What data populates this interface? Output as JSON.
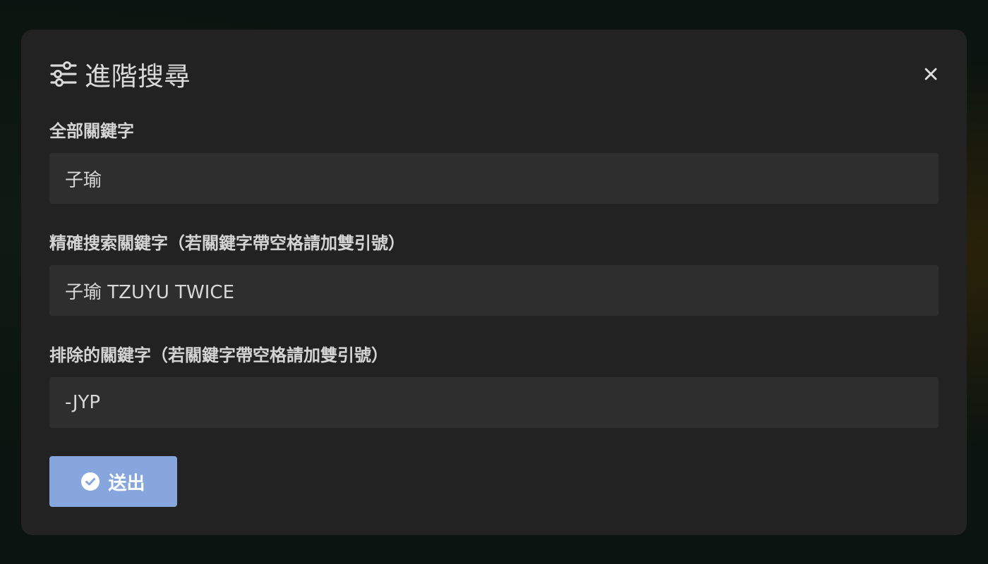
{
  "modal": {
    "title": "進階搜尋",
    "title_icon": "sliders-icon",
    "close_icon": "close-icon"
  },
  "fields": {
    "all_keywords": {
      "label": "全部關鍵字",
      "value": "子瑜"
    },
    "exact_keywords": {
      "label": "精確搜索關鍵字（若關鍵字帶空格請加雙引號）",
      "value": "子瑜 TZUYU TWICE"
    },
    "excluded_keywords": {
      "label": "排除的關鍵字（若關鍵字帶空格請加雙引號）",
      "value": "-JYP"
    }
  },
  "submit": {
    "label": "送出",
    "icon": "check-circle-icon",
    "color": "#86a6dd"
  }
}
